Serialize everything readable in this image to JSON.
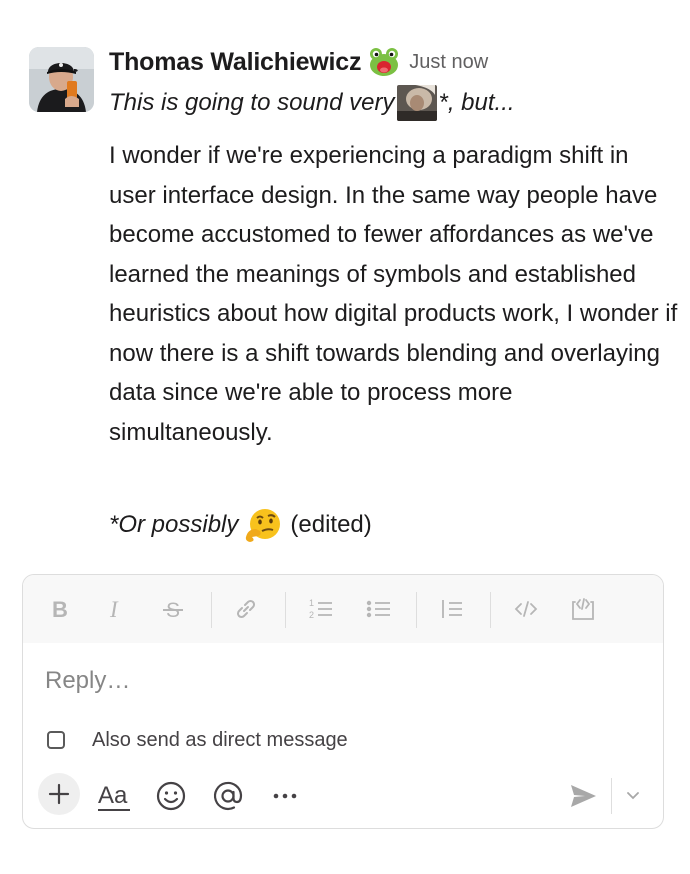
{
  "message": {
    "sender_name": "Thomas Walichiewicz",
    "status_emoji": "frog-emoji",
    "timestamp": "Just now",
    "intro_before": "This is going to sound very ",
    "intro_after": "*, but...",
    "body": "I wonder if we're experiencing a paradigm shift in user interface design. In the same way people have become accustomed to fewer affordances as we've learned the meanings of symbols and established heuristics about how digital products work, I wonder if now there is a shift towards blending and overlaying data since we're able to process more simultaneously.",
    "footnote": "*Or possibly",
    "footnote_emoji": "thinking-emoji",
    "edited_label": "(edited)"
  },
  "composer": {
    "toolbar": [
      "bold",
      "italic",
      "strikethrough",
      "link",
      "ordered-list",
      "bulleted-list",
      "blockquote",
      "code",
      "code-block"
    ],
    "reply_placeholder": "Reply…",
    "reply_value": "",
    "also_send_dm_label": "Also send as direct message",
    "also_send_dm_checked": false,
    "bottom_actions": [
      "attach",
      "formatting",
      "emoji",
      "mention",
      "more"
    ],
    "formatting_label": "Aa"
  },
  "colors": {
    "text": "#1d1c1d",
    "muted": "#616061",
    "toolbar_bg": "#f8f8f8",
    "icon_disabled": "#b6b6b6",
    "border": "#dddddd"
  }
}
